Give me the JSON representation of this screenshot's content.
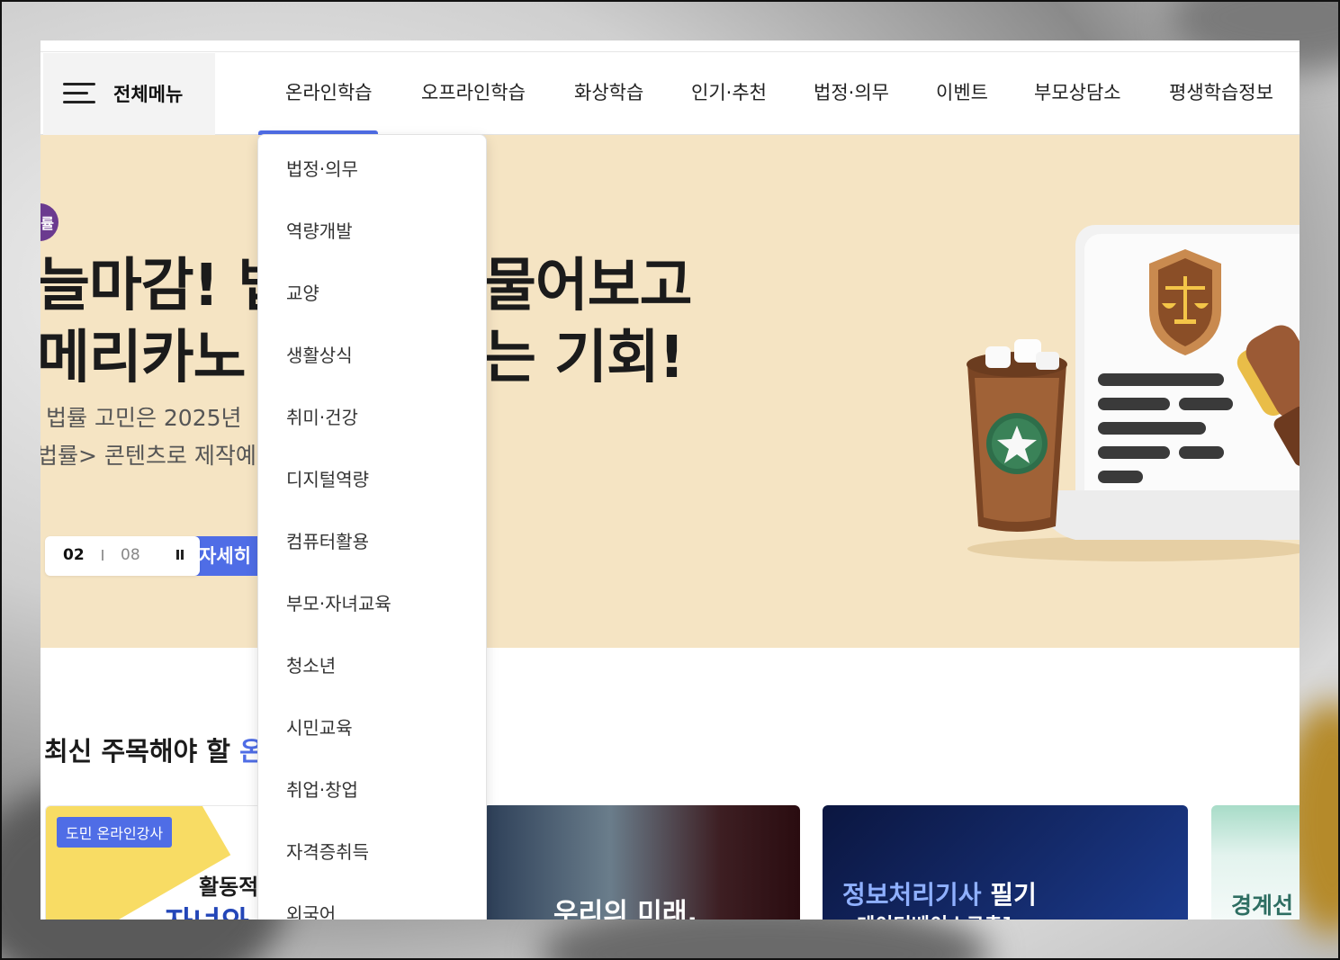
{
  "nav": {
    "all_menu_label": "전체메뉴",
    "items": [
      "온라인학습",
      "오프라인학습",
      "화상학습",
      "인기·추천",
      "법정·의무",
      "이벤트",
      "부모상담소",
      "평생학습정보"
    ],
    "active_index": 0
  },
  "dropdown": {
    "items": [
      "법정·의무",
      "역량개발",
      "교양",
      "생활상식",
      "취미·건강",
      "디지털역량",
      "컴퓨터활용",
      "부모·자녀교육",
      "청소년",
      "시민교육",
      "취업·창업",
      "자격증취득",
      "외국어"
    ]
  },
  "hero": {
    "badge_text": "률",
    "title_line1_left": "늘마감! 법",
    "title_line1_right": "물어보고",
    "title_line2_left": "메리카노 ",
    "title_line2_right": "는 기회!",
    "sub_line1": "법률 고민은 2025년 ",
    "sub_line2": "법률> 콘텐츠로 제작예정",
    "pager_current": "02",
    "pager_total": "08",
    "detail_button": "자세히 보기"
  },
  "section": {
    "title_prefix": "최신 주목해야 할 ",
    "title_accent": "온"
  },
  "cards": [
    {
      "tag": "도민 온라인강사",
      "line1": "활동적",
      "line2": "자녀와"
    },
    {
      "title": "우리의 미래,"
    },
    {
      "title_a": "정보처리기사",
      "title_b": " 필기",
      "subtitle": "데이터베이스구축]"
    },
    {
      "title": "경계선"
    }
  ],
  "colors": {
    "accent": "#4f6de6",
    "hero_bg": "#f5e4c3",
    "badge": "#6b3a8f"
  }
}
